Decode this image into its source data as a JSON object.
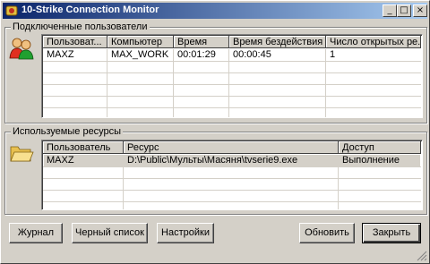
{
  "window": {
    "title": "10-Strike Connection Monitor",
    "minimize_glyph": "_",
    "maximize_glyph": "□",
    "close_glyph": "×"
  },
  "users_group": {
    "label": "Подключенные пользователи",
    "icon": "users-icon",
    "columns": [
      "Пользоват...",
      "Компьютер",
      "Время",
      "Время бездействия",
      "Число открытых ре..."
    ],
    "rows": [
      [
        "MAXZ",
        "MAX_WORK",
        "00:01:29",
        "00:00:45",
        "1"
      ]
    ]
  },
  "resources_group": {
    "label": "Используемые ресурсы",
    "icon": "folder-open-icon",
    "columns": [
      "Пользователь",
      "Ресурс",
      "Доступ"
    ],
    "rows": [
      [
        "MAXZ",
        "D:\\Public\\Мульты\\Масяня\\tvserie9.exe",
        "Выполнение"
      ]
    ]
  },
  "buttons": {
    "journal": "Журнал",
    "blacklist": "Черный список",
    "settings": "Настройки",
    "refresh": "Обновить",
    "close": "Закрыть"
  },
  "colors": {
    "titlebar_start": "#0a246a",
    "titlebar_end": "#a6caf0",
    "face": "#d4d0c8"
  }
}
